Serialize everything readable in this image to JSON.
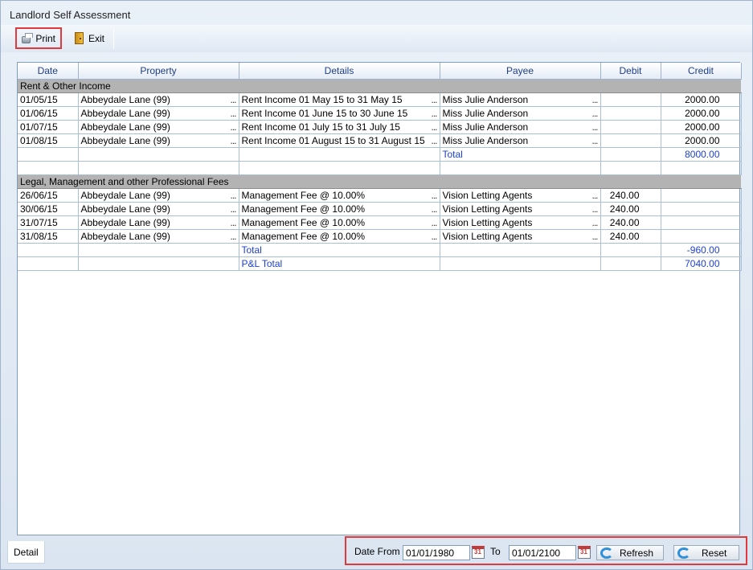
{
  "window": {
    "title": "Landlord Self Assessment"
  },
  "toolbar": {
    "print_label": "Print",
    "exit_label": "Exit"
  },
  "columns": [
    "Date",
    "Property",
    "Details",
    "Payee",
    "Debit",
    "Credit"
  ],
  "groups": [
    {
      "name": "Rent & Other Income",
      "rows": [
        {
          "date": "01/05/15",
          "property": "Abbeydale Lane (99)",
          "details": "Rent Income 01 May 15 to 31 May 15",
          "payee": "Miss Julie Anderson",
          "debit": "",
          "credit": "2000.00"
        },
        {
          "date": "01/06/15",
          "property": "Abbeydale Lane (99)",
          "details": "Rent Income 01 June 15 to 30 June 15",
          "payee": "Miss Julie Anderson",
          "debit": "",
          "credit": "2000.00"
        },
        {
          "date": "01/07/15",
          "property": "Abbeydale Lane (99)",
          "details": "Rent Income 01 July 15 to 31 July 15",
          "payee": "Miss Julie Anderson",
          "debit": "",
          "credit": "2000.00"
        },
        {
          "date": "01/08/15",
          "property": "Abbeydale Lane (99)",
          "details": "Rent Income 01 August 15 to 31 August 15",
          "payee": "Miss Julie Anderson",
          "debit": "",
          "credit": "2000.00"
        }
      ],
      "total_label": "Total",
      "total_value": "8000.00"
    },
    {
      "name": "Legal, Management and other Professional Fees",
      "rows": [
        {
          "date": "26/06/15",
          "property": "Abbeydale Lane (99)",
          "details": "Management Fee @ 10.00%",
          "payee": "Vision Letting Agents",
          "debit": "240.00",
          "credit": ""
        },
        {
          "date": "30/06/15",
          "property": "Abbeydale Lane (99)",
          "details": "Management Fee @ 10.00%",
          "payee": "Vision Letting Agents",
          "debit": "240.00",
          "credit": ""
        },
        {
          "date": "31/07/15",
          "property": "Abbeydale Lane (99)",
          "details": "Management Fee @ 10.00%",
          "payee": "Vision Letting Agents",
          "debit": "240.00",
          "credit": ""
        },
        {
          "date": "31/08/15",
          "property": "Abbeydale Lane (99)",
          "details": "Management Fee @ 10.00%",
          "payee": "Vision Letting Agents",
          "debit": "240.00",
          "credit": ""
        }
      ],
      "total_label": "Total",
      "total_value": "-960.00"
    }
  ],
  "pl_total": {
    "label": "P&L Total",
    "value": "7040.00"
  },
  "ellipsis": "...",
  "footer": {
    "tab_label": "Detail",
    "date_from_label": "Date From",
    "date_from_value": "01/01/1980",
    "to_label": "To",
    "to_value": "01/01/2100",
    "refresh_label": "Refresh",
    "reset_label": "Reset"
  },
  "colors": {
    "accent_text": "#1c3fd6",
    "group_bg": "#b3b3b3",
    "highlight": "#e0393e"
  }
}
